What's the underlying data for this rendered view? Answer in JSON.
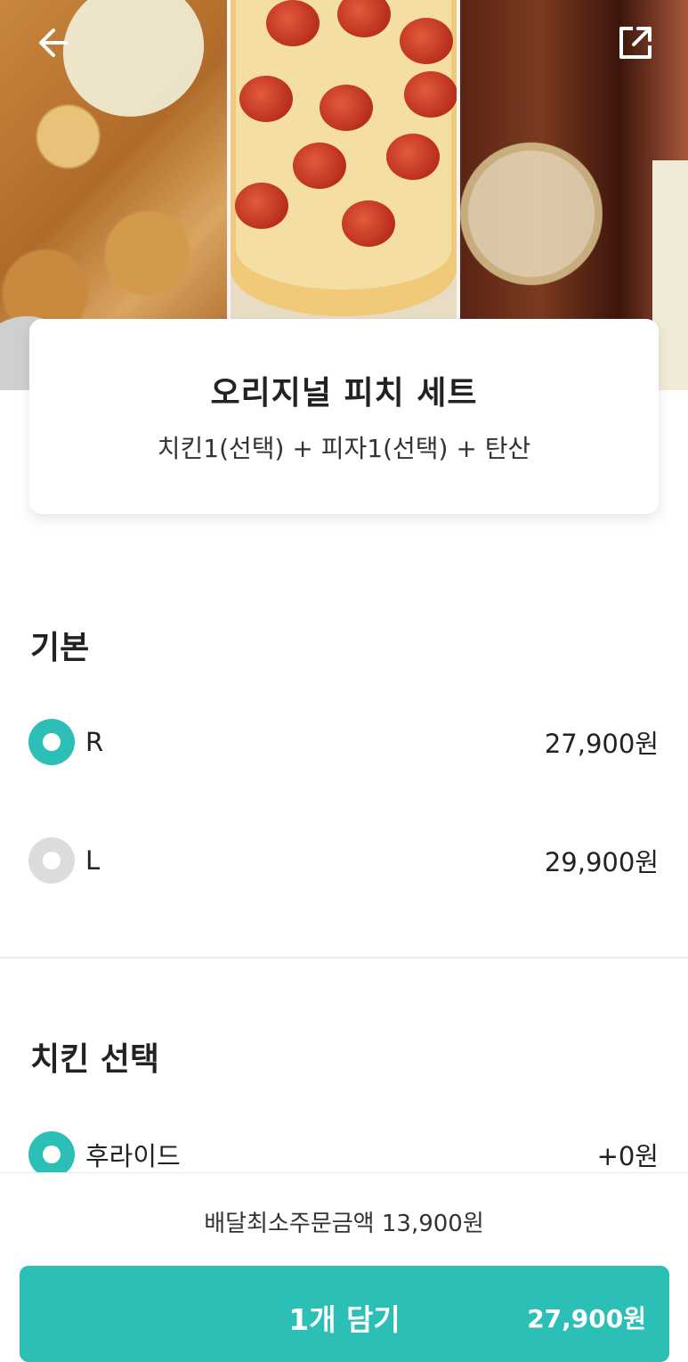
{
  "header": {
    "back_icon": "arrow-left-icon",
    "share_icon": "external-share-icon"
  },
  "menu": {
    "title": "오리지널 피치 세트",
    "description": "치킨1(선택) + 피자1(선택) + 탄산"
  },
  "sections": [
    {
      "title": "기본",
      "options": [
        {
          "label": "R",
          "price": "27,900원",
          "selected": true
        },
        {
          "label": "L",
          "price": "29,900원",
          "selected": false
        }
      ]
    },
    {
      "title": "치킨 선택",
      "options": [
        {
          "label": "후라이드",
          "price": "+0원",
          "selected": true
        }
      ]
    }
  ],
  "footer": {
    "min_order": "배달최소주문금액 13,900원",
    "add_label": "1개 담기",
    "add_price": "27,900원"
  },
  "colors": {
    "accent": "#2bbfb5",
    "radio_off": "#dcdcdc"
  }
}
